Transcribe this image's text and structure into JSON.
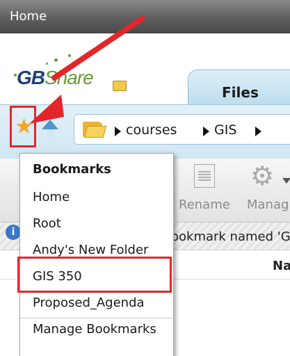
{
  "window": {
    "title": "Home"
  },
  "logo": {
    "text_part1": "GB",
    "text_part2": "Share"
  },
  "tabs": [
    {
      "label": "Files"
    }
  ],
  "path": {
    "crumbs": [
      "courses",
      "GIS"
    ]
  },
  "toolbar": {
    "rename_label": "Rename",
    "manage_label": "Manag"
  },
  "status": {
    "text": "ookmark named 'G"
  },
  "file_list": {
    "name_header": "Na"
  },
  "bookmarks_menu": {
    "title": "Bookmarks",
    "items": [
      "Home",
      "Root",
      "Andy's New Folder",
      "GIS 350",
      "Proposed_Agenda"
    ],
    "manage": "Manage Bookmarks"
  },
  "annotations": {
    "highlight_color": "#e62629"
  }
}
